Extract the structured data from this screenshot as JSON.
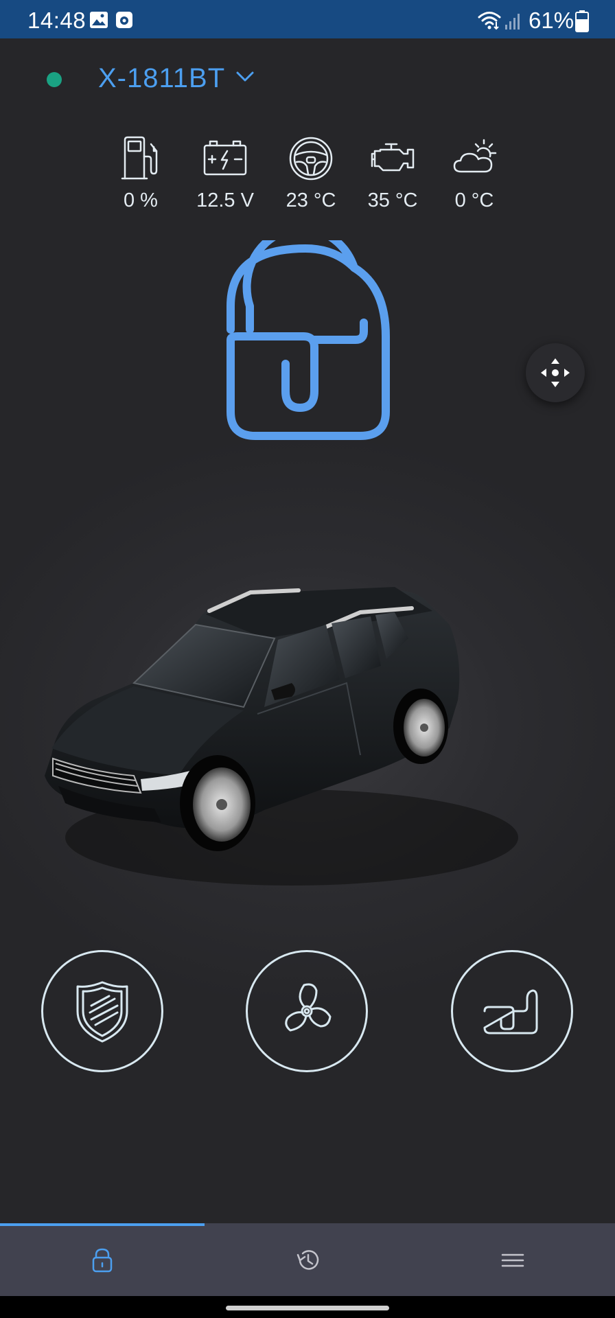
{
  "status_bar": {
    "time": "14:48",
    "battery": "61%"
  },
  "device": {
    "name": "X-1811BT",
    "connection_status_color": "#1aa283"
  },
  "indicators": [
    {
      "icon": "fuel-icon",
      "value": "0 %"
    },
    {
      "icon": "car-battery-icon",
      "value": "12.5 V"
    },
    {
      "icon": "steering-wheel-icon",
      "value": "23 °C"
    },
    {
      "icon": "engine-icon",
      "value": "35 °C"
    },
    {
      "icon": "weather-icon",
      "value": "0 °C"
    }
  ],
  "lock": {
    "state": "unlocked",
    "icon": "unlocked-padlock-icon"
  },
  "actions": [
    {
      "icon": "shield-icon"
    },
    {
      "icon": "fan-icon"
    },
    {
      "icon": "car-seat-icon"
    }
  ],
  "bottom_nav": {
    "active_tab": 0,
    "tabs": [
      {
        "icon": "lock-icon"
      },
      {
        "icon": "history-icon"
      },
      {
        "icon": "menu-icon"
      }
    ]
  },
  "colors": {
    "accent": "#4c9ff0",
    "status_bar": "#174a82",
    "background": "#262629",
    "nav_bar": "#41424f",
    "icon_stroke": "#d8e8f0"
  }
}
